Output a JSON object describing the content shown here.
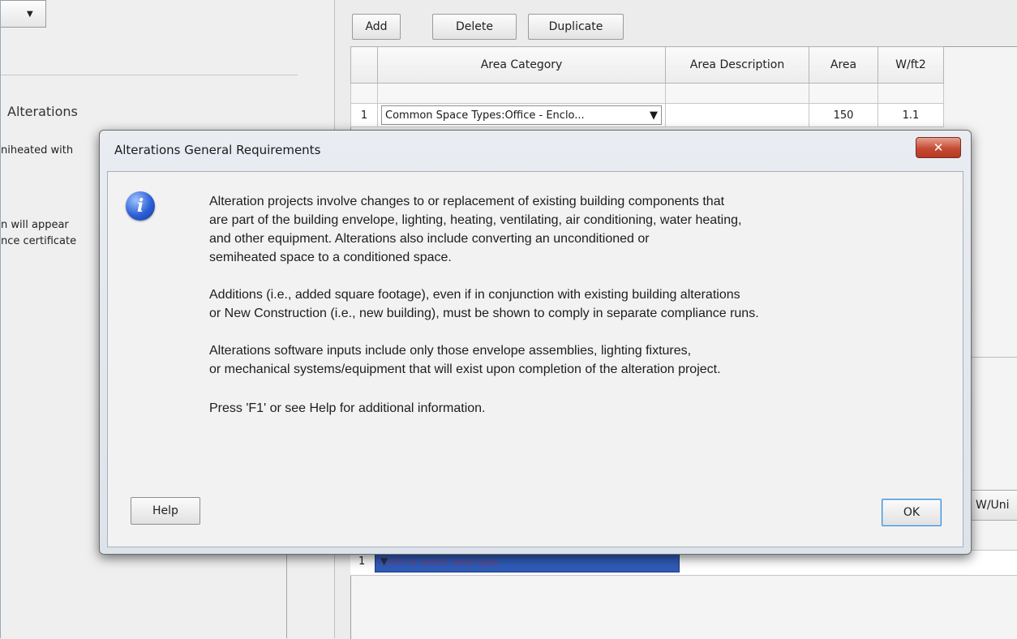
{
  "background": {
    "left": {
      "heading": "Alterations",
      "fragments": [
        "niheated with",
        "n will appear",
        "nce certificate"
      ]
    },
    "toolbar": {
      "add": "Add",
      "delete": "Delete",
      "duplicate": "Duplicate"
    },
    "table": {
      "headers": [
        "",
        "Area Category",
        "Area Description",
        "Area",
        "W/ft2"
      ],
      "row1": {
        "num": "1",
        "category": "Common Space Types:Office - Enclo...",
        "description": "",
        "area": "150",
        "wft2": "1.1"
      }
    },
    "lower": {
      "wunit_label": "W/Uni",
      "row_num": "1",
      "row_select": "Click to select area type"
    }
  },
  "dialog": {
    "title": "Alterations General Requirements",
    "close_label": "✕",
    "paragraphs": [
      [
        "Alteration projects involve changes to or replacement of existing building components that",
        "are part of the building envelope, lighting, heating, ventilating, air conditioning, water heating,",
        "and other equipment. Alterations also include converting an unconditioned or",
        "semiheated space to a conditioned space."
      ],
      [
        "Additions (i.e., added square footage), even if in conjunction with existing building alterations",
        "or New Construction (i.e., new building), must be shown to comply in separate compliance runs."
      ],
      [
        "Alterations software inputs include only those envelope assemblies, lighting fixtures,",
        "or mechanical systems/equipment that will exist upon completion of the alteration project."
      ],
      [
        "Press 'F1' or see Help for additional information."
      ]
    ],
    "help_label": "Help",
    "ok_label": "OK"
  },
  "colors": {
    "close_button": "#c64a33",
    "info_icon": "#2c5fd6",
    "default_button_border": "#3c8ad4"
  }
}
